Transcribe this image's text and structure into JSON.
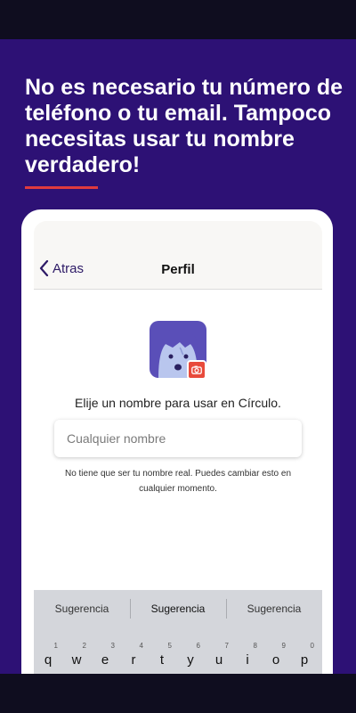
{
  "headline": "No es necesario tu número de teléfono o tu email. Tampoco necesitas usar tu nombre verdadero!",
  "colors": {
    "background": "#2d1175",
    "accent_rule": "#e03a3e",
    "camera_badge": "#e84a3b",
    "avatar": "#5a4fb8"
  },
  "navbar": {
    "back_label": "Atras",
    "title": "Perfil"
  },
  "profile": {
    "avatar_icon": "face-avatar-icon",
    "camera_icon": "camera-icon",
    "prompt": "Elije un nombre para usar en Círculo.",
    "name_input": {
      "placeholder": "Cualquier nombre",
      "value": ""
    },
    "hint": "No tiene que ser tu nombre real. Puedes cambiar esto en cualquier momento."
  },
  "keyboard": {
    "suggestions": [
      "Sugerencia",
      "Sugerencia",
      "Sugerencia"
    ],
    "keys": [
      {
        "num": "1",
        "char": "q"
      },
      {
        "num": "2",
        "char": "w"
      },
      {
        "num": "3",
        "char": "e"
      },
      {
        "num": "4",
        "char": "r"
      },
      {
        "num": "5",
        "char": "t"
      },
      {
        "num": "6",
        "char": "y"
      },
      {
        "num": "7",
        "char": "u"
      },
      {
        "num": "8",
        "char": "i"
      },
      {
        "num": "9",
        "char": "o"
      },
      {
        "num": "0",
        "char": "p"
      }
    ]
  }
}
